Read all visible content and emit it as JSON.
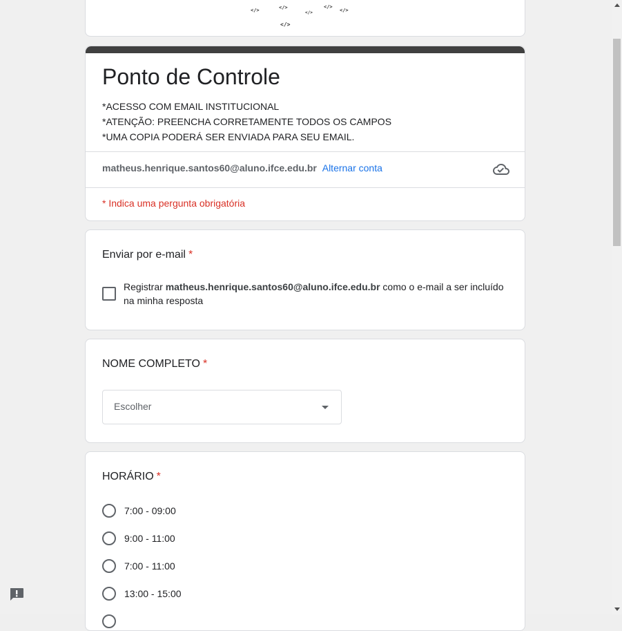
{
  "banner": {
    "glyphs": [
      "</>",
      "</>",
      "</>",
      "</>",
      "</>",
      "</>"
    ]
  },
  "form": {
    "title": "Ponto de Controle",
    "description": [
      "*ACESSO COM EMAIL INSTITUCIONAL",
      "*ATENÇÃO: PREENCHA CORRETAMENTE TODOS OS CAMPOS",
      "*UMA COPIA PODERÁ SER ENVIADA PARA SEU EMAIL."
    ],
    "account_email": "matheus.henrique.santos60@aluno.ifce.edu.br",
    "switch_account": "Alternar conta",
    "required_note": "* Indica uma pergunta obrigatória"
  },
  "questions": {
    "email": {
      "title": "Enviar por e-mail",
      "asterisk": "*",
      "checkbox_prefix": "Registrar",
      "checkbox_email": "matheus.henrique.santos60@aluno.ifce.edu.br",
      "checkbox_suffix": "como o e-mail a ser incluído na minha resposta"
    },
    "name": {
      "title": "NOME COMPLETO",
      "asterisk": "*",
      "placeholder": "Escolher"
    },
    "time": {
      "title": "HORÁRIO",
      "asterisk": "*",
      "options": [
        "7:00 - 09:00",
        "9:00 - 11:00",
        "7:00 - 11:00",
        "13:00 - 15:00"
      ]
    }
  },
  "icons": {
    "cloud": "cloud-saved-icon",
    "feedback": "feedback-icon"
  },
  "colors": {
    "required": "#d93025",
    "link": "#1a73e8",
    "header_bar": "#404040"
  }
}
